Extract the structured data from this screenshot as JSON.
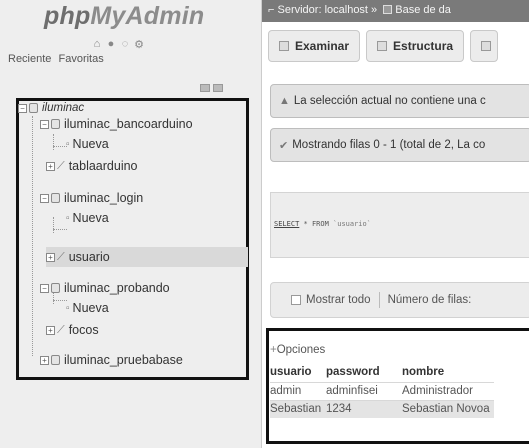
{
  "logo": {
    "prefix": "php",
    "suffix": "MyAdmin"
  },
  "quick_icons": [
    "home-icon",
    "exit-icon",
    "help-icon",
    "settings-icon"
  ],
  "recent_tabs": [
    "Reciente",
    "Favoritas"
  ],
  "tree": {
    "root": "iluminac",
    "nodes": [
      {
        "label": "iluminac_bancoarduino"
      },
      {
        "label": "Nueva"
      },
      {
        "label": "tablaarduino"
      },
      {
        "label": "iluminac_login"
      },
      {
        "label": "Nueva"
      },
      {
        "label": "usuario"
      },
      {
        "label": "iluminac_probando"
      },
      {
        "label": "Nueva"
      },
      {
        "label": "focos"
      },
      {
        "label": "iluminac_pruebabase"
      }
    ]
  },
  "breadcrumb": {
    "server": "Servidor: localhost »",
    "db": "Base de da"
  },
  "tabs": [
    {
      "label": "Examinar",
      "icon": "browse-icon"
    },
    {
      "label": "Estructura",
      "icon": "structure-icon"
    }
  ],
  "notices": {
    "warning": "La selección actual no contiene una c",
    "success": "Mostrando filas 0 - 1 (total de 2, La co"
  },
  "sql": {
    "keyword": "SELECT",
    "rest": " * FROM ",
    "table": "`usuario`"
  },
  "show_bar": {
    "show_all": "Mostrar todo",
    "rows_label": "Número de filas:"
  },
  "options_label": "Opciones",
  "result": {
    "columns": [
      "usuario",
      "password",
      "nombre"
    ],
    "rows": [
      [
        "admin",
        "adminfisei",
        "Administrador"
      ],
      [
        "Sebastian",
        "1234",
        "Sebastian Novoa"
      ]
    ]
  },
  "colors": {
    "breadcrumb_bg": "#7a7a7a",
    "left_panel_bg": "#eeeeee",
    "frame": "#111111"
  }
}
